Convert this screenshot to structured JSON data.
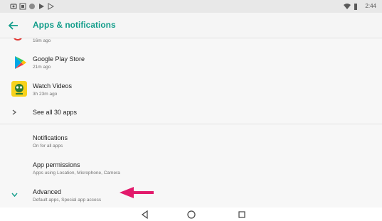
{
  "status_bar": {
    "time": "2:44",
    "icons": [
      "cast-icon",
      "sim-icon",
      "sync-icon",
      "play-icon",
      "play-store-icon",
      "wifi-icon",
      "battery-icon"
    ]
  },
  "header": {
    "title": "Apps & notifications"
  },
  "recent_apps": [
    {
      "name": "",
      "time": "16m ago",
      "icon": "app-icon-partial"
    },
    {
      "name": "Google Play Store",
      "time": "21m ago",
      "icon": "play-store-icon"
    },
    {
      "name": "Watch Videos",
      "time": "3h 23m ago",
      "icon": "watch-videos-icon"
    }
  ],
  "see_all": {
    "label": "See all 30 apps"
  },
  "settings": [
    {
      "title": "Notifications",
      "subtitle": "On for all apps"
    },
    {
      "title": "App permissions",
      "subtitle": "Apps using Location, Microphone, Camera"
    },
    {
      "title": "Advanced",
      "subtitle": "Default apps, Special app access"
    }
  ],
  "annotation": {
    "color": "#e21a6b"
  },
  "colors": {
    "accent": "#129d8a",
    "text": "#212121",
    "secondary": "#737373"
  }
}
